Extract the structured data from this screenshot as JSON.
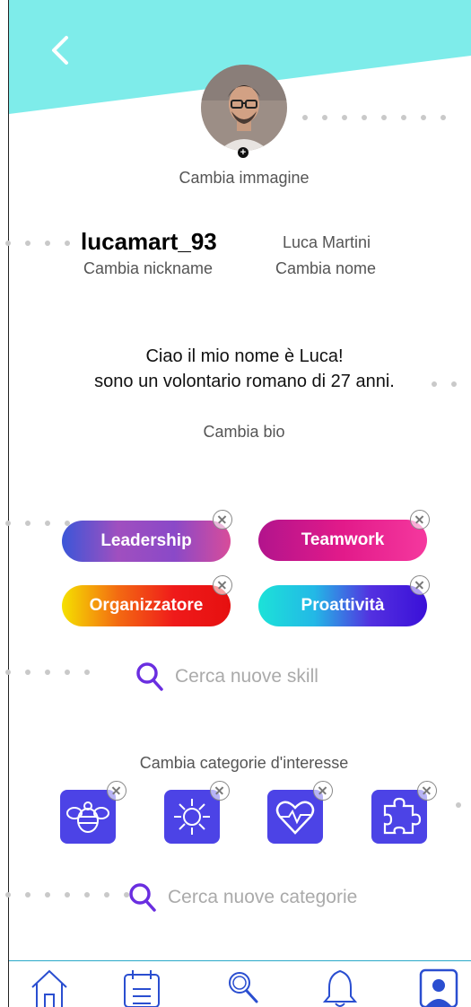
{
  "profile": {
    "change_image": "Cambia immagine",
    "nickname": "lucamart_93",
    "change_nickname": "Cambia nickname",
    "full_name": "Luca Martini",
    "change_name": "Cambia nome",
    "bio_line1": "Ciao il mio nome è Luca!",
    "bio_line2": "sono un volontario romano di 27 anni.",
    "change_bio": "Cambia bio"
  },
  "skills": [
    {
      "label": "Leadership"
    },
    {
      "label": "Teamwork"
    },
    {
      "label": "Organizzatore"
    },
    {
      "label": "Proattività"
    }
  ],
  "search_skill": "Cerca nuove skill",
  "categories_title": "Cambia categorie d'interesse",
  "categories": [
    "bee-icon",
    "splash-icon",
    "heart-pulse-icon",
    "puzzle-icon"
  ],
  "search_category": "Cerca nuove categorie",
  "nav": [
    "home-icon",
    "calendar-icon",
    "search-icon",
    "bell-icon",
    "profile-icon"
  ],
  "colors": {
    "header": "#7eecea",
    "accent": "#6a2ee0",
    "category": "#4c43e6"
  }
}
